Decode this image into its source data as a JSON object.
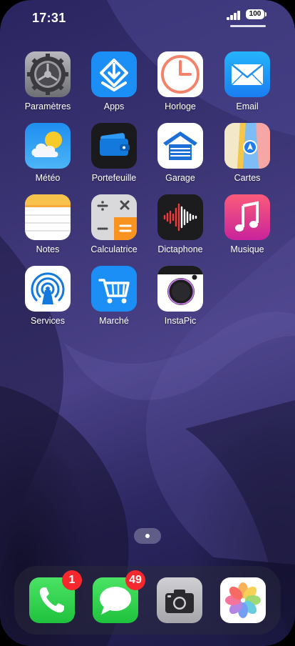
{
  "status": {
    "time": "17:31",
    "battery": "100"
  },
  "apps": [
    {
      "label": "Paramètres",
      "icon": "settings-gear-icon"
    },
    {
      "label": "Apps",
      "icon": "app-store-download-icon"
    },
    {
      "label": "Horloge",
      "icon": "clock-icon"
    },
    {
      "label": "Email",
      "icon": "mail-envelope-icon"
    },
    {
      "label": "Météo",
      "icon": "weather-sun-cloud-icon"
    },
    {
      "label": "Portefeuille",
      "icon": "wallet-cards-icon"
    },
    {
      "label": "Garage",
      "icon": "garage-icon"
    },
    {
      "label": "Cartes",
      "icon": "maps-navigation-icon"
    },
    {
      "label": "Notes",
      "icon": "notes-paper-icon"
    },
    {
      "label": "Calculatrice",
      "icon": "calculator-icon"
    },
    {
      "label": "Dictaphone",
      "icon": "voice-waveform-icon"
    },
    {
      "label": "Musique",
      "icon": "music-note-icon"
    },
    {
      "label": "Services",
      "icon": "airdrop-rings-icon"
    },
    {
      "label": "Marché",
      "icon": "shopping-cart-icon"
    },
    {
      "label": "InstaPic",
      "icon": "camera-lens-icon"
    }
  ],
  "dock": [
    {
      "name": "phone",
      "icon": "phone-handset-icon",
      "badge": "1"
    },
    {
      "name": "messages",
      "icon": "message-bubble-icon",
      "badge": "49"
    },
    {
      "name": "camera",
      "icon": "camera-icon",
      "badge": ""
    },
    {
      "name": "photos",
      "icon": "photos-flower-icon",
      "badge": ""
    }
  ],
  "colors": {
    "badge": "#f5282e",
    "wallpaper": "#3b3474"
  }
}
